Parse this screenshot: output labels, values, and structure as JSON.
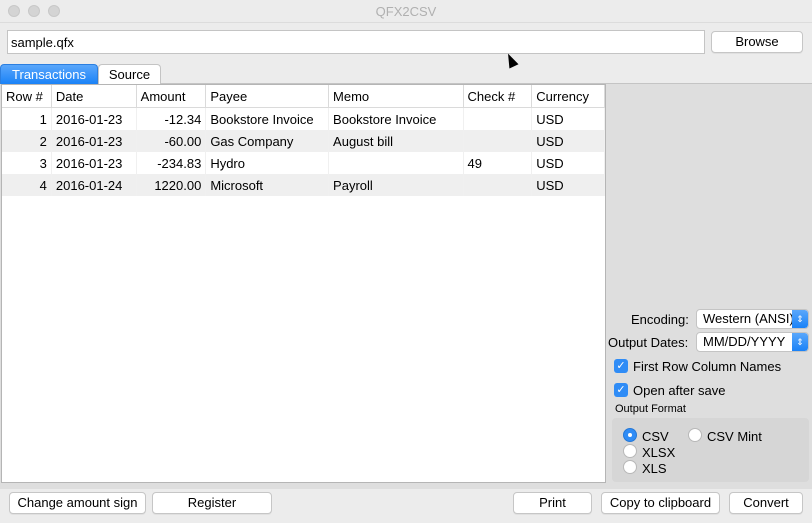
{
  "window": {
    "title": "QFX2CSV"
  },
  "file": {
    "path": "sample.qfx",
    "browse_label": "Browse"
  },
  "tabs": [
    {
      "label": "Transactions",
      "active": true
    },
    {
      "label": "Source",
      "active": false
    }
  ],
  "table": {
    "columns": [
      "Row #",
      "Date",
      "Amount",
      "Payee",
      "Memo",
      "Check #",
      "Currency"
    ],
    "rows": [
      [
        "1",
        "2016-01-23",
        "-12.34",
        "Bookstore Invoice",
        "Bookstore Invoice",
        "",
        "USD"
      ],
      [
        "2",
        "2016-01-23",
        "-60.00",
        "Gas Company",
        "August bill",
        "",
        "USD"
      ],
      [
        "3",
        "2016-01-23",
        "-234.83",
        "Hydro",
        "",
        "49",
        "USD"
      ],
      [
        "4",
        "2016-01-24",
        "1220.00",
        "Microsoft",
        "Payroll",
        "",
        "USD"
      ]
    ]
  },
  "options": {
    "encoding_label": "Encoding:",
    "encoding_value": "Western (ANSI)",
    "output_dates_label": "Output Dates:",
    "output_dates_value": "MM/DD/YYYY",
    "first_row_label": "First Row Column Names",
    "first_row_checked": true,
    "open_after_save_label": "Open after save",
    "open_after_save_checked": true,
    "output_format_label": "Output Format",
    "formats": [
      {
        "label": "CSV",
        "selected": true
      },
      {
        "label": "CSV Mint",
        "selected": false
      },
      {
        "label": "XLSX",
        "selected": false
      },
      {
        "label": "XLS",
        "selected": false
      }
    ]
  },
  "buttons": {
    "change_sign": "Change amount sign",
    "register": "Register",
    "print": "Print",
    "copy": "Copy to clipboard",
    "convert": "Convert"
  },
  "icons": {
    "check": "✓",
    "updown": "⇕"
  },
  "colors": {
    "accent": "#1a82f7"
  }
}
